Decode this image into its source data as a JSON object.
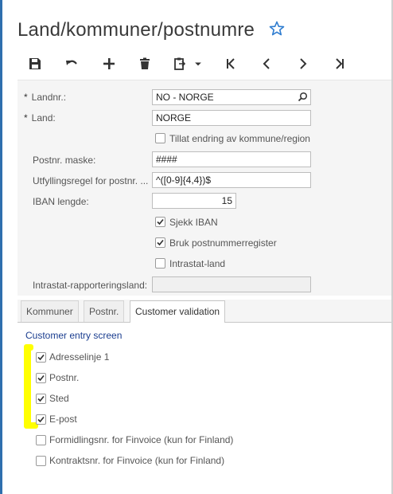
{
  "header": {
    "title": "Land/kommuner/postnumre"
  },
  "toolbar": {
    "icons": [
      "save-icon",
      "undo-icon",
      "add-icon",
      "delete-icon",
      "clipboard-icon",
      "chevron-down-icon",
      "first-icon",
      "previous-icon",
      "next-icon",
      "last-icon"
    ]
  },
  "form": {
    "landnr_label": "Landnr.:",
    "landnr_value": "NO - NORGE",
    "land_label": "Land:",
    "land_value": "NORGE",
    "tillat_label": "Tillat endring av kommune/region",
    "postnr_maske_label": "Postnr. maske:",
    "postnr_maske_value": "####",
    "utfylling_label": "Utfyllingsregel for postnr. ...",
    "utfylling_value": "^([0-9]{4,4})$",
    "iban_label": "IBAN lengde:",
    "iban_value": "15",
    "sjekk_iban_label": "Sjekk IBAN",
    "bruk_postnr_label": "Bruk postnummerregister",
    "intrastat_label": "Intrastat-land",
    "intrastat_rap_label": "Intrastat-rapporteringsland:",
    "intrastat_rap_value": ""
  },
  "tabs": [
    {
      "label": "Kommuner"
    },
    {
      "label": "Postnr."
    },
    {
      "label": "Customer validation"
    }
  ],
  "customer_validation": {
    "section_title": "Customer entry screen",
    "items": [
      {
        "label": "Adresselinje 1",
        "checked": true
      },
      {
        "label": "Postnr.",
        "checked": true
      },
      {
        "label": "Sted",
        "checked": true
      },
      {
        "label": "E-post",
        "checked": true
      },
      {
        "label": "Formidlingsnr. for Finvoice (kun for Finland)",
        "checked": false
      },
      {
        "label": "Kontraktsnr. for Finvoice (kun for Finland)",
        "checked": false
      }
    ]
  },
  "colors": {
    "accent": "#2f6fae",
    "link": "#1a3d8f",
    "highlight": "#ffff00"
  }
}
